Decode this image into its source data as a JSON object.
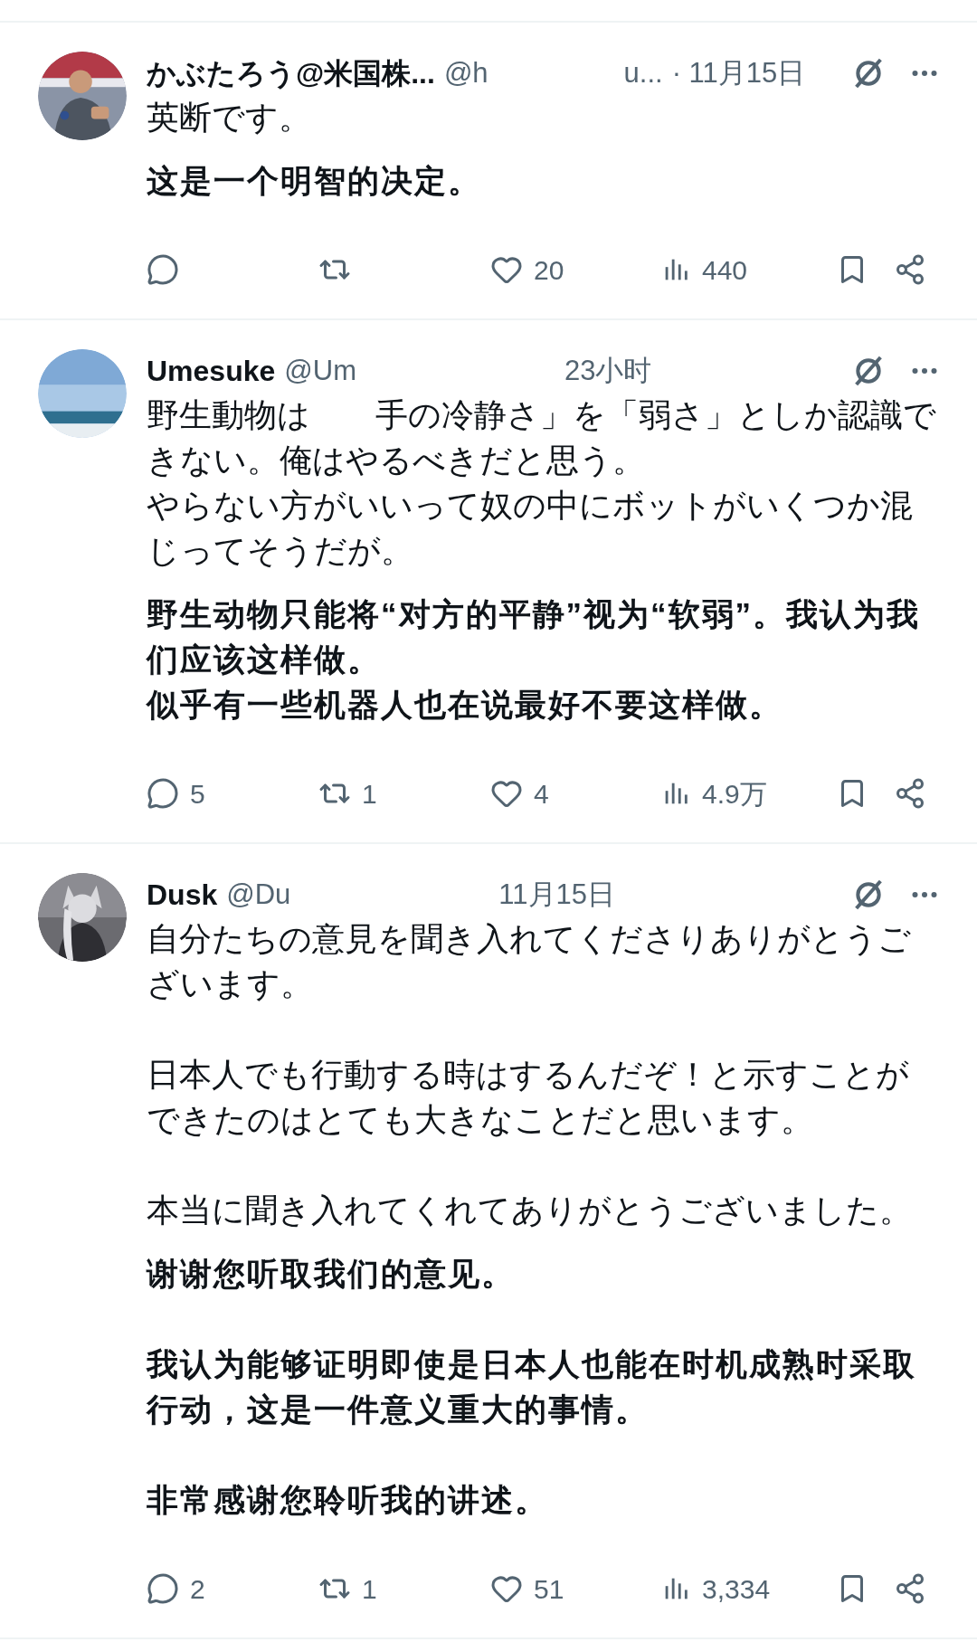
{
  "posts": [
    {
      "avatar": {
        "kind": "picture"
      },
      "name": "かぶたろう@米国株...",
      "handle": [
        "@h",
        "u..."
      ],
      "time": "· 11月15日",
      "body": [
        [
          "英断です。"
        ]
      ],
      "translation": [
        [
          "这是一个明智的决定。"
        ]
      ],
      "actions": [
        {
          "kind": "reply"
        },
        {
          "kind": "repost"
        },
        {
          "kind": "like",
          "count": "20"
        },
        {
          "kind": "views",
          "count": "440"
        },
        {
          "kind": "bookmark"
        },
        {
          "kind": "share"
        }
      ]
    },
    {
      "avatar": {
        "kind": "picture"
      },
      "name": "Umesuke",
      "handle": [
        "@Um"
      ],
      "time": "23小时",
      "body": [
        [
          "野生動物は　　手の冷静さ」を「弱さ」としか認識できない。俺はやるべきだと思う。",
          "やらない方がいいって奴の中にボットがいくつか混じってそうだが。"
        ]
      ],
      "translation": [
        [
          "野生动物只能将“对方的平静”视为“软弱”。我认为我们应该这样做。",
          "似乎有一些机器人也在说最好不要这样做。"
        ]
      ],
      "actions": [
        {
          "kind": "reply",
          "count": "5"
        },
        {
          "kind": "repost",
          "count": "1"
        },
        {
          "kind": "like",
          "count": "4"
        },
        {
          "kind": "views",
          "count": "4.9万"
        },
        {
          "kind": "bookmark"
        },
        {
          "kind": "share"
        }
      ]
    },
    {
      "avatar": {
        "kind": "picture"
      },
      "name": "Dusk",
      "handle": [
        "@Du"
      ],
      "time": "11月15日",
      "body": [
        [
          "自分たちの意見を聞き入れてくださりありがとうございます。"
        ],
        [
          "日本人でも行動する時はするんだぞ！と示すことができたのはとても大きなことだと思います。"
        ],
        [
          "本当に聞き入れてくれてありがとうございました。"
        ]
      ],
      "translation": [
        [
          "谢谢您听取我们的意见。"
        ],
        [
          "我认为能够证明即使是日本人也能在时机成熟时采取行动，这是一件意义重大的事情。"
        ],
        [
          "非常感谢您聆听我的讲述。"
        ]
      ],
      "actions": [
        {
          "kind": "reply",
          "count": "2"
        },
        {
          "kind": "repost",
          "count": "1"
        },
        {
          "kind": "like",
          "count": "51"
        },
        {
          "kind": "views",
          "count": "3,334"
        },
        {
          "kind": "bookmark"
        },
        {
          "kind": "share"
        }
      ]
    }
  ]
}
